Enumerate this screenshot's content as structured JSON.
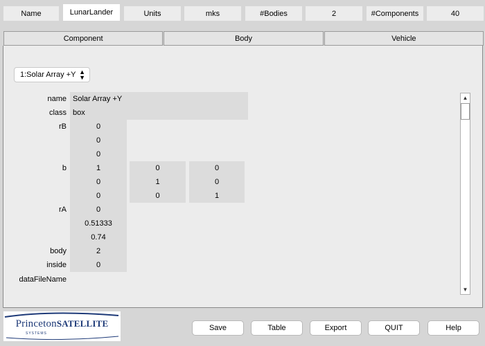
{
  "info": {
    "name_label": "Name",
    "name_value": "LunarLander",
    "units_label": "Units",
    "units_value": "mks",
    "bodies_label": "#Bodies",
    "bodies_value": "2",
    "components_label": "#Components",
    "components_value": "40"
  },
  "tabs": [
    "Component",
    "Body",
    "Vehicle"
  ],
  "selector": {
    "value": "1:Solar Array +Y"
  },
  "fields": {
    "name_label": "name",
    "name_value": "Solar Array +Y",
    "class_label": "class",
    "class_value": "box",
    "rB_label": "rB",
    "rB": [
      "0",
      "0",
      "0"
    ],
    "b_label": "b",
    "b": [
      [
        "1",
        "0",
        "0"
      ],
      [
        "0",
        "1",
        "0"
      ],
      [
        "0",
        "0",
        "1"
      ]
    ],
    "rA_label": "rA",
    "rA": [
      "0",
      "0.51333",
      "0.74"
    ],
    "body_label": "body",
    "body_value": "2",
    "inside_label": "inside",
    "inside_value": "0",
    "datafile_label": "dataFileName"
  },
  "logo": {
    "princeton": "Princeton",
    "satellite": "SATELLITE",
    "systems": "SYSTEMS"
  },
  "buttons": {
    "save": "Save",
    "table": "Table",
    "export": "Export",
    "quit": "QUIT",
    "help": "Help"
  },
  "icons": {
    "dropdown": "chevron-updown-icon",
    "scroll_up": "triangle-up-icon",
    "scroll_down": "triangle-down-icon"
  }
}
